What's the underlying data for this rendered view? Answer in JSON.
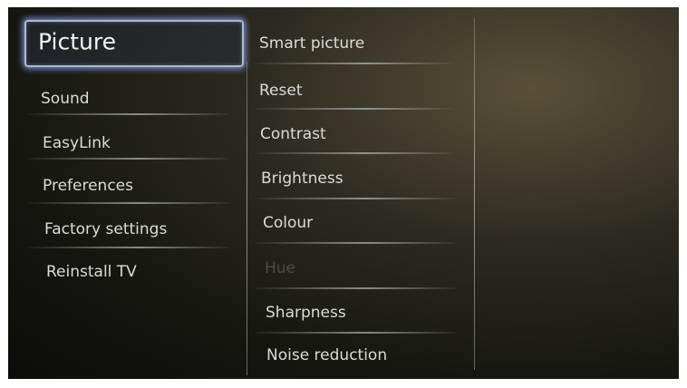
{
  "main_menu": {
    "selected": "Picture",
    "items": [
      {
        "label": "Picture"
      },
      {
        "label": "Sound"
      },
      {
        "label": "EasyLink"
      },
      {
        "label": "Preferences"
      },
      {
        "label": "Factory settings"
      },
      {
        "label": "Reinstall TV"
      }
    ]
  },
  "submenu": {
    "items": [
      {
        "label": "Smart picture",
        "enabled": true
      },
      {
        "label": "Reset",
        "enabled": true
      },
      {
        "label": "Contrast",
        "enabled": true
      },
      {
        "label": "Brightness",
        "enabled": true
      },
      {
        "label": "Colour",
        "enabled": true
      },
      {
        "label": "Hue",
        "enabled": false
      },
      {
        "label": "Sharpness",
        "enabled": true
      },
      {
        "label": "Noise reduction",
        "enabled": true
      }
    ]
  },
  "colors": {
    "selection_glow": "#82a5eb",
    "text": "#d9ddd8",
    "disabled_text": "#4b4d48"
  }
}
